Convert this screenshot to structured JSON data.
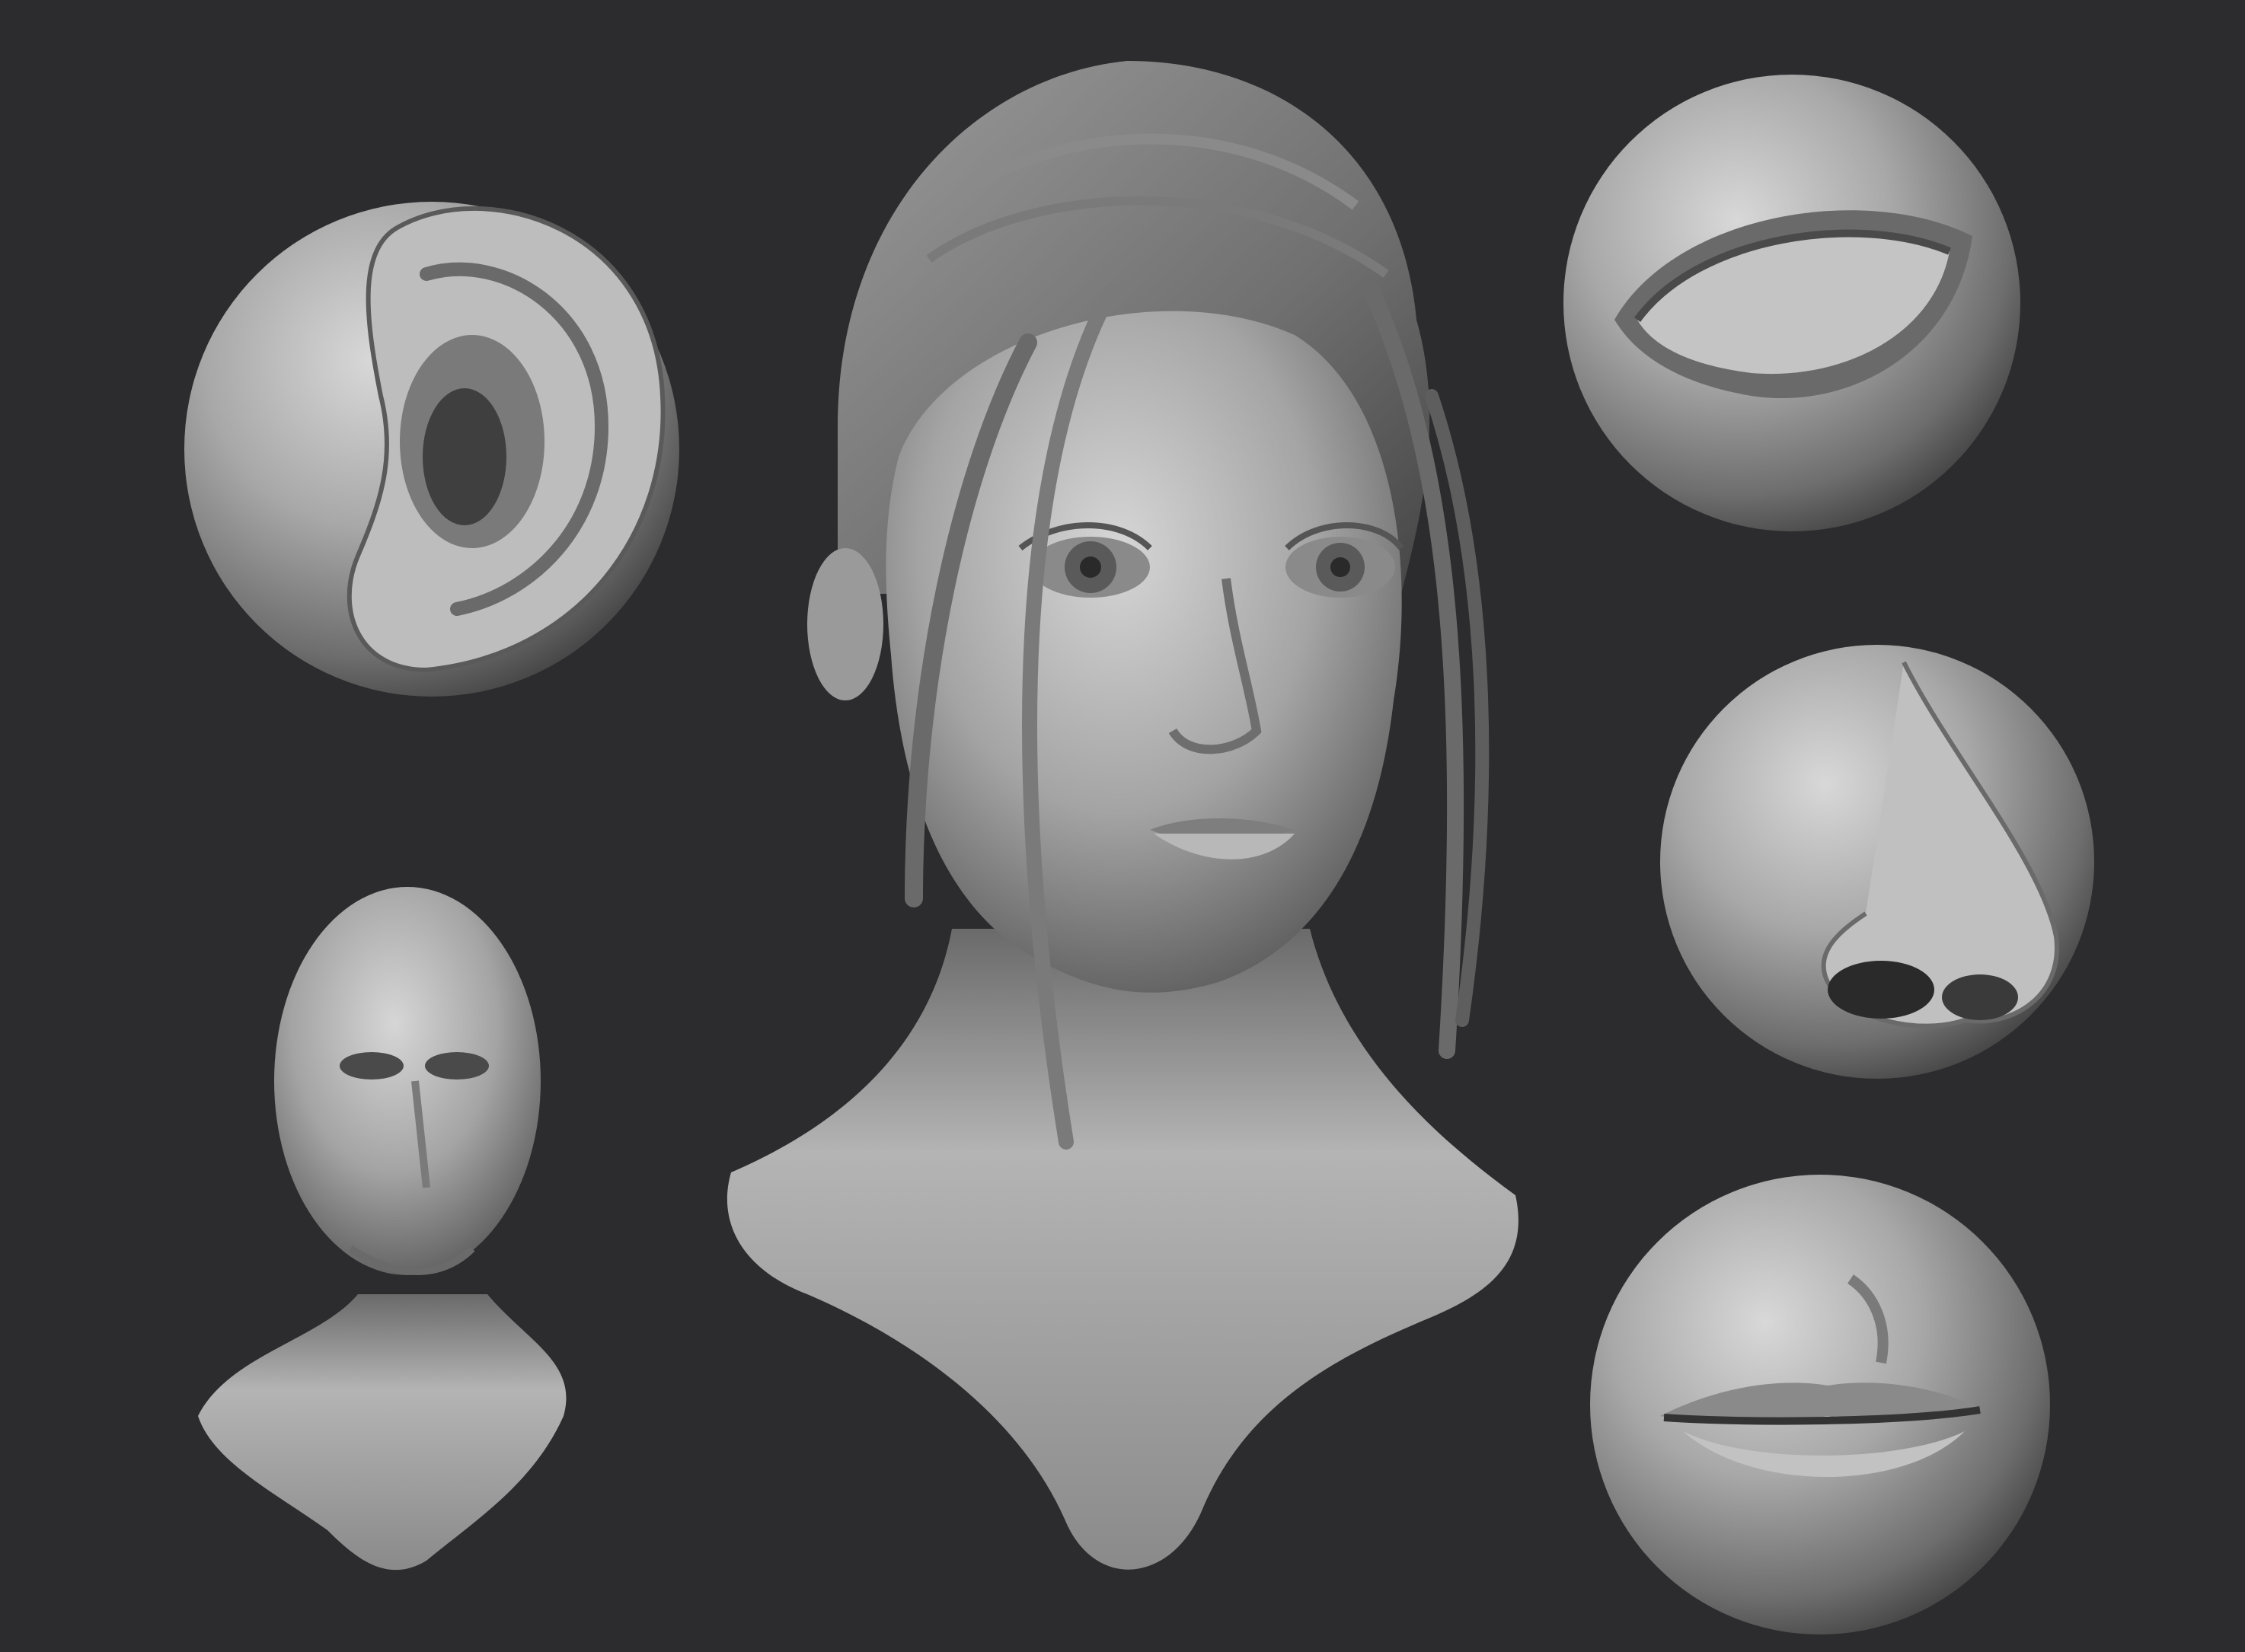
{
  "scene": {
    "background": "#2c2c2e",
    "clay_light": "#d2d2d2",
    "clay_mid": "#8e8e8e",
    "clay_dark": "#3a3a3a",
    "objects": [
      {
        "id": "ear-sphere",
        "depicts": "ear-sculpt"
      },
      {
        "id": "eye-sphere",
        "depicts": "eye-sculpt"
      },
      {
        "id": "nose-sphere",
        "depicts": "nose-sculpt"
      },
      {
        "id": "mouth-sphere",
        "depicts": "lips-sculpt"
      },
      {
        "id": "blockout-head",
        "depicts": "base-head-bust"
      },
      {
        "id": "female-bust",
        "depicts": "female-head-bust"
      }
    ]
  }
}
